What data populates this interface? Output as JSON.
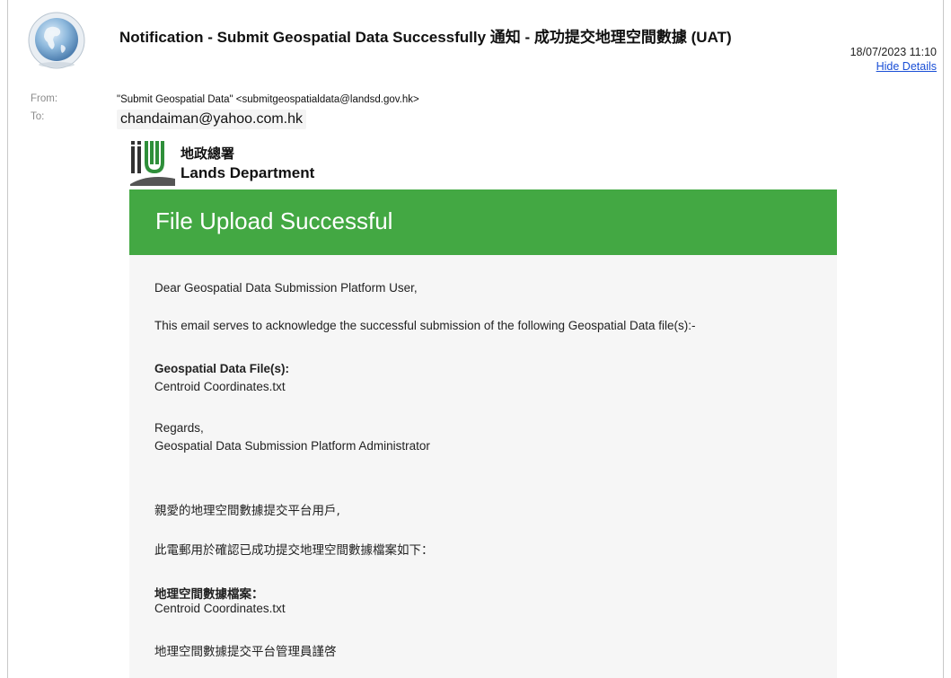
{
  "header": {
    "subject": "Notification - Submit Geospatial Data Successfully 通知 - 成功提交地理空間數據 (UAT)",
    "date": "18/07/2023 11:10",
    "hide_details": "Hide Details"
  },
  "meta": {
    "from_label": "From:",
    "from_value": "\"Submit Geospatial Data\" <submitgeospatialdata@landsd.gov.hk>",
    "to_label": "To:",
    "to_value": "chandaiman@yahoo.com.hk"
  },
  "logo": {
    "name_zh": "地政總署",
    "name_en": "Lands Department"
  },
  "banner": {
    "title": "File Upload Successful"
  },
  "email": {
    "greeting": "Dear Geospatial Data Submission Platform User,",
    "intro": "This email serves to acknowledge the successful submission of the following Geospatial Data file(s):-",
    "files_heading": "Geospatial Data File(s):",
    "file_name": "Centroid Coordinates.txt",
    "regards": "Regards,",
    "signature": "Geospatial Data Submission Platform Administrator",
    "greeting_zh": "親愛的地理空間數據提交平台用戶,",
    "intro_zh": "此電郵用於確認已成功提交地理空間數據檔案如下：",
    "files_heading_zh": "地理空間數據檔案：",
    "file_name_zh": "Centroid Coordinates.txt",
    "signature_zh": "地理空間數據提交平台管理員謹啓"
  },
  "colors": {
    "banner_green": "#43a843",
    "link_blue": "#1a4fd6"
  },
  "icons": {
    "avatar": "globe-icon",
    "logo": "lands-department-logo"
  }
}
